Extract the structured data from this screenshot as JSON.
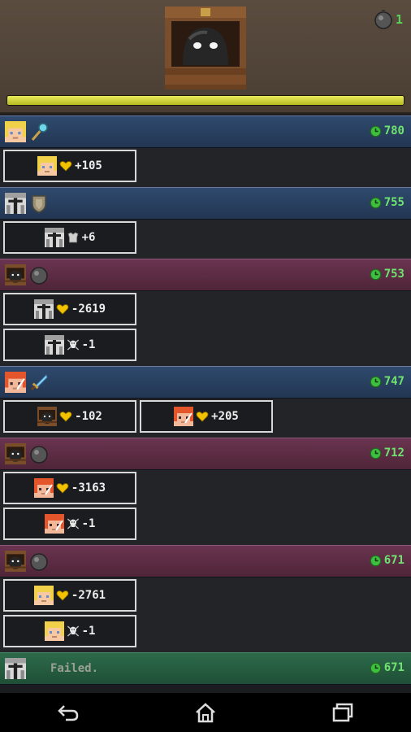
{
  "header": {
    "bomb_count": "1",
    "hp_percent": 100
  },
  "rows": [
    {
      "kind": "hero",
      "actor": "blonde-hero-icon",
      "item": "magic-wand-icon",
      "score": "780",
      "effects": [
        {
          "actor": "blonde-hero-icon",
          "stat": "heart-icon",
          "value": "+105"
        }
      ]
    },
    {
      "kind": "hero",
      "actor": "knight-icon",
      "item": "shield-icon",
      "score": "755",
      "effects": [
        {
          "actor": "knight-icon",
          "stat": "armor-icon",
          "value": "+6"
        }
      ]
    },
    {
      "kind": "enemy",
      "actor": "chest-monster-icon",
      "item": "bomb-icon",
      "score": "753",
      "effects": [
        {
          "actor": "knight-icon",
          "stat": "heart-icon",
          "value": "-2619"
        },
        {
          "actor": "knight-icon",
          "stat": "skull-icon",
          "value": "-1"
        }
      ]
    },
    {
      "kind": "hero",
      "actor": "redhead-hero-icon",
      "item": "dagger-icon",
      "score": "747",
      "effects": [
        {
          "actor": "chest-monster-icon",
          "stat": "heart-icon",
          "value": "-102"
        },
        {
          "actor": "redhead-hero-icon",
          "stat": "heart-icon",
          "value": "+205"
        }
      ]
    },
    {
      "kind": "enemy",
      "actor": "chest-monster-icon",
      "item": "bomb-icon",
      "score": "712",
      "effects": [
        {
          "actor": "redhead-hero-icon",
          "stat": "heart-icon",
          "value": "-3163"
        },
        {
          "actor": "redhead-hero-icon",
          "stat": "skull-icon",
          "value": "-1"
        }
      ]
    },
    {
      "kind": "enemy",
      "actor": "chest-monster-icon",
      "item": "bomb-icon",
      "score": "671",
      "effects": [
        {
          "actor": "blonde-hero-icon",
          "stat": "heart-icon",
          "value": "-2761"
        },
        {
          "actor": "blonde-hero-icon",
          "stat": "skull-icon",
          "value": "-1"
        }
      ]
    },
    {
      "kind": "fail",
      "actor": "knight-icon",
      "text": "Failed.",
      "score": "671",
      "effects": []
    }
  ],
  "nav": [
    "back-icon",
    "home-icon",
    "recent-apps-icon"
  ],
  "colors": {
    "score_green": "#6fe36f",
    "hero_row": "#2f4a6e",
    "enemy_row": "#6a3450",
    "fail_row": "#2d6a4a",
    "hp_bar": "#d8da3e",
    "heart": "#f2c200"
  }
}
